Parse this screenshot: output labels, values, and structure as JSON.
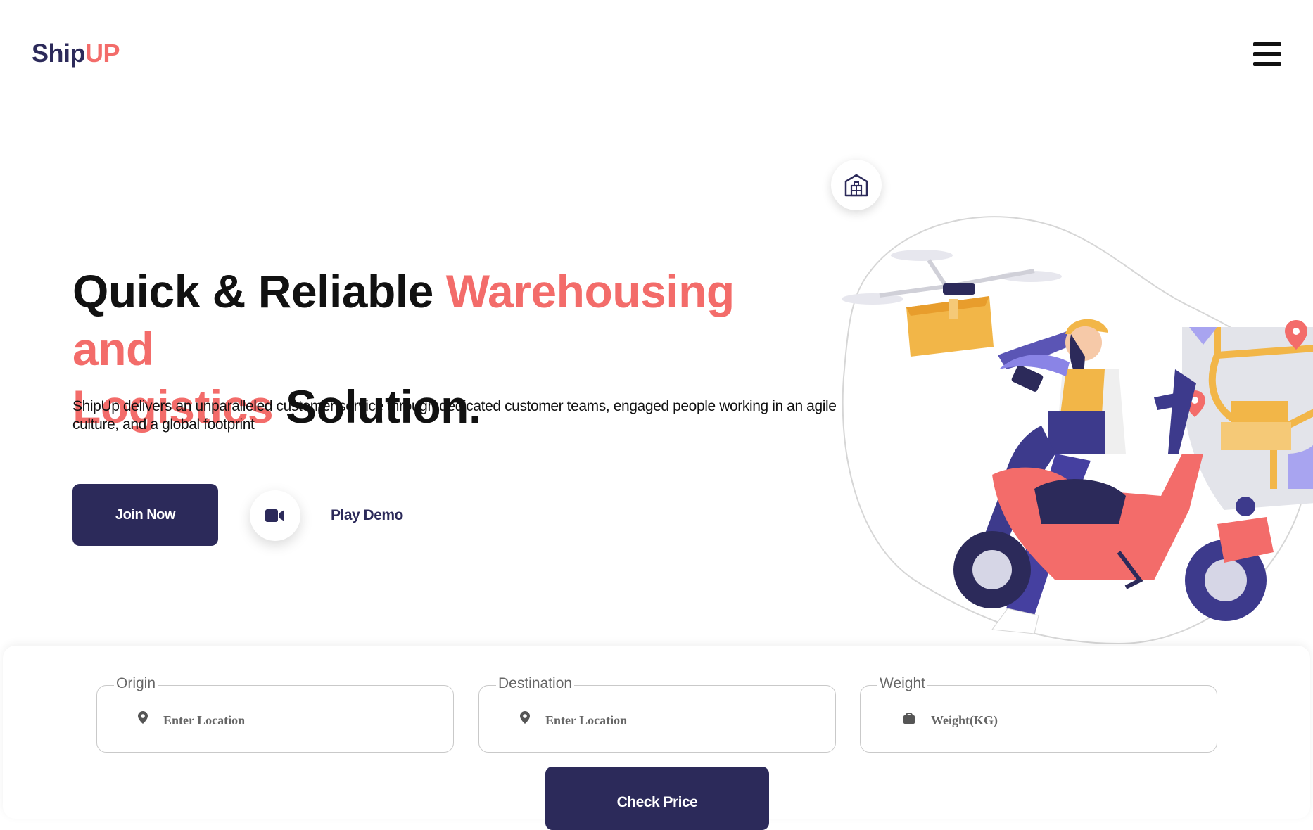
{
  "header": {
    "logo_part1": "Ship",
    "logo_part2": "UP"
  },
  "hero": {
    "title_part1": "Quick & Reliable ",
    "title_highlight1": "Warehousing and",
    "title_highlight2": "Logistics",
    "title_part2": " Solution.",
    "description": "ShipUp delivers an unparalleled customer service through dedicated customer teams, engaged people working in an agile culture, and a global footprint",
    "join_label": "Join Now",
    "demo_label": "Play Demo"
  },
  "form": {
    "origin": {
      "label": "Origin",
      "placeholder": "Enter Location"
    },
    "destination": {
      "label": "Destination",
      "placeholder": "Enter Location"
    },
    "weight": {
      "label": "Weight",
      "placeholder": "Weight(KG)"
    },
    "submit_label": "Check Price"
  },
  "colors": {
    "primary": "#2c2a5a",
    "accent": "#f36c6a"
  },
  "icons": [
    "menu-icon",
    "video-camera-icon",
    "warehouse-icon",
    "location-pin-icon",
    "bag-icon"
  ]
}
